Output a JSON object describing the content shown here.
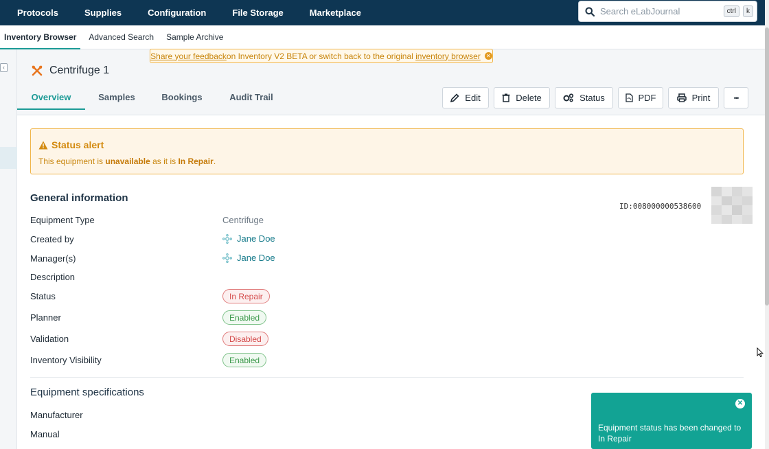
{
  "topnav": {
    "items": [
      "Protocols",
      "Supplies",
      "Configuration",
      "File Storage",
      "Marketplace"
    ],
    "search_placeholder": "Search eLabJournal",
    "shortcut_ctrl": "ctrl",
    "shortcut_k": "k"
  },
  "subnav": {
    "items": [
      "Inventory Browser",
      "Advanced Search",
      "Sample Archive"
    ],
    "active": "Inventory Browser"
  },
  "banner": {
    "link1": "Share your feedback ",
    "middle": "on Inventory V2 BETA or switch back to the original ",
    "link2": "inventory browser"
  },
  "item": {
    "title": "Centrifuge 1"
  },
  "tabs": [
    "Overview",
    "Samples",
    "Bookings",
    "Audit Trail"
  ],
  "actions": {
    "edit": "Edit",
    "delete": "Delete",
    "status": "Status",
    "pdf": "PDF",
    "print": "Print",
    "more": "•••"
  },
  "alert": {
    "title": "Status alert",
    "msg_prefix": "This equipment is ",
    "msg_bold1": "unavailable",
    "msg_mid": " as it is ",
    "msg_bold2": "In Repair",
    "msg_suffix": "."
  },
  "general": {
    "title": "General information",
    "id_text": "ID:008000000538600",
    "fields": {
      "equipment_type_label": "Equipment Type",
      "equipment_type_value": "Centrifuge",
      "created_by_label": "Created by",
      "created_by_value": "Jane Doe",
      "managers_label": "Manager(s)",
      "managers_value": "Jane Doe",
      "description_label": "Description",
      "status_label": "Status",
      "status_value": "In Repair",
      "planner_label": "Planner",
      "planner_value": "Enabled",
      "validation_label": "Validation",
      "validation_value": "Disabled",
      "visibility_label": "Inventory Visibility",
      "visibility_value": "Enabled"
    }
  },
  "specs": {
    "title": "Equipment specifications",
    "manufacturer_label": "Manufacturer",
    "manual_label": "Manual"
  },
  "toast": {
    "message": "Equipment status has been changed to In Repair"
  },
  "colors": {
    "nav_bg": "#0e3653",
    "accent_teal": "#1b9a95",
    "alert_orange": "#d38a0f",
    "toast_bg": "#12a394",
    "badge_red": "#d44a4a",
    "badge_green": "#3e9a4d"
  }
}
